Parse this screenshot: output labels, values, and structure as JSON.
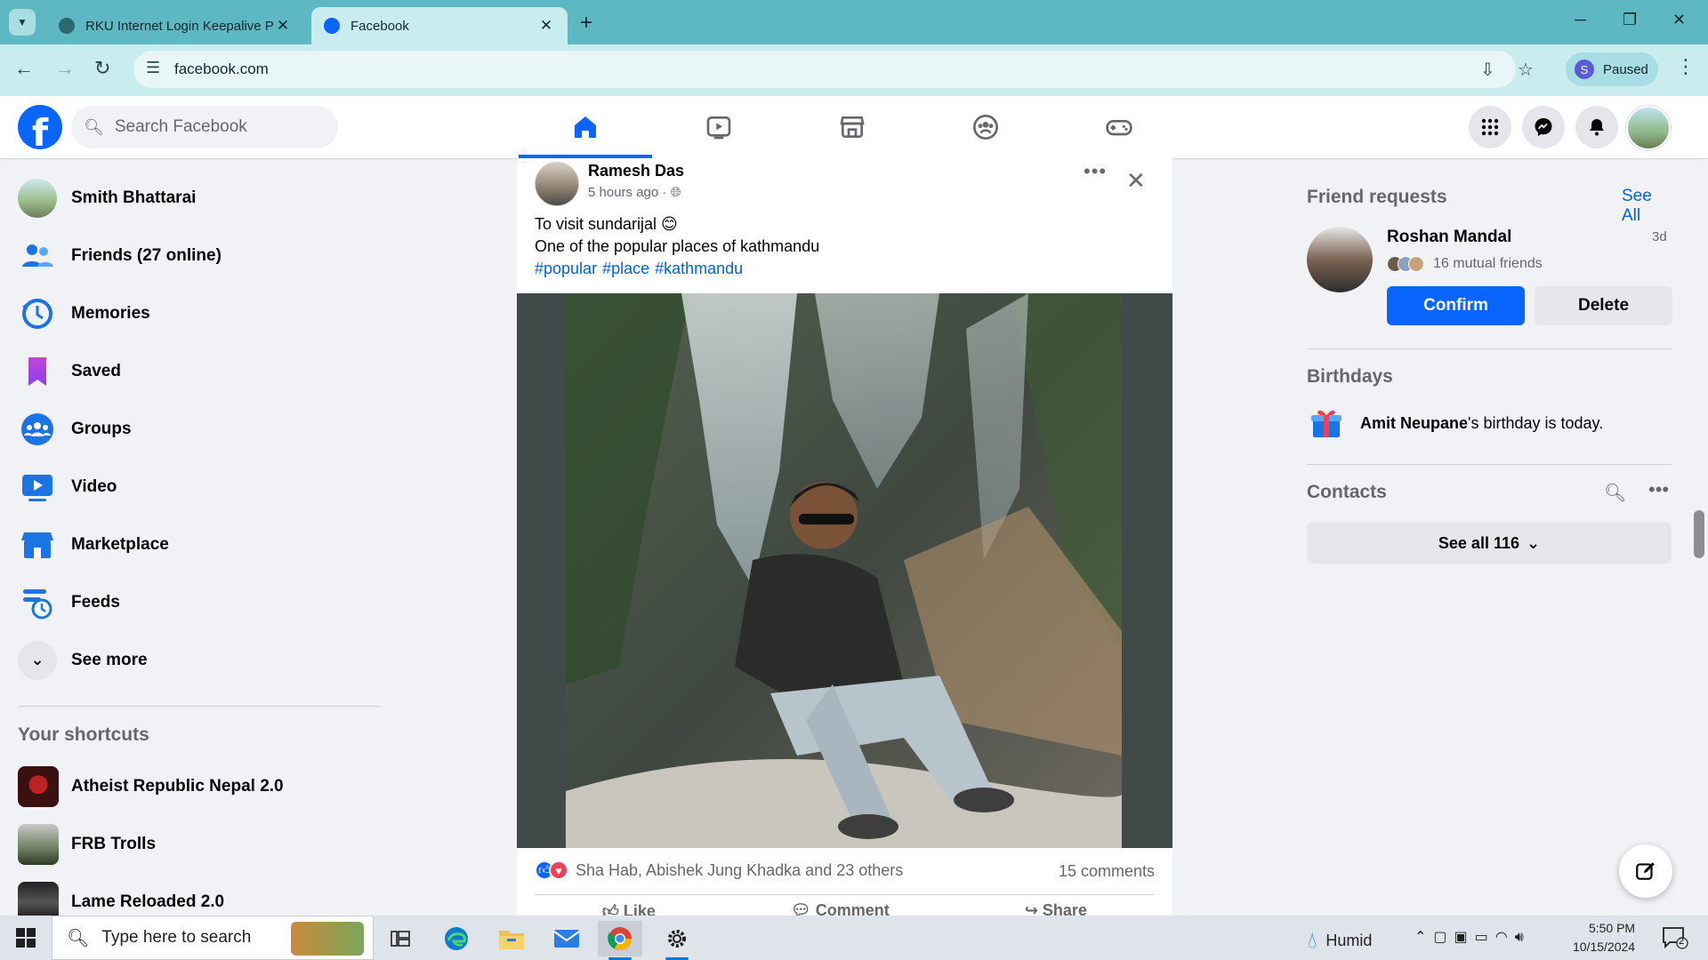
{
  "browser": {
    "tabs": [
      {
        "title": "RKU Internet Login Keepalive P",
        "active": false
      },
      {
        "title": "Facebook",
        "active": true
      }
    ],
    "url": "facebook.com",
    "profile_status": "Paused",
    "profile_initial": "S"
  },
  "header": {
    "search_placeholder": "Search Facebook",
    "nav": [
      "home-icon",
      "video-icon",
      "marketplace-icon",
      "groups-icon",
      "gaming-icon"
    ],
    "brand_color": "#0866ff"
  },
  "sidebar": {
    "items": [
      {
        "label": "Smith Bhattarai",
        "icon": "profile-avatar"
      },
      {
        "label": "Friends (27 online)",
        "icon": "friends-icon"
      },
      {
        "label": "Memories",
        "icon": "memories-icon"
      },
      {
        "label": "Saved",
        "icon": "saved-icon"
      },
      {
        "label": "Groups",
        "icon": "groups-icon"
      },
      {
        "label": "Video",
        "icon": "video-icon"
      },
      {
        "label": "Marketplace",
        "icon": "marketplace-icon"
      },
      {
        "label": "Feeds",
        "icon": "feeds-icon"
      },
      {
        "label": "See more",
        "icon": "chevron-down-icon"
      }
    ],
    "shortcuts_title": "Your shortcuts",
    "shortcuts": [
      {
        "label": "Atheist Republic Nepal 2.0"
      },
      {
        "label": "FRB Trolls"
      },
      {
        "label": "Lame Reloaded 2.0"
      }
    ]
  },
  "post": {
    "author": "Ramesh Das",
    "time": "5 hours ago ·",
    "line1": "To visit sundarijal 😊",
    "line2": "One of the popular places of kathmandu",
    "hashtags": [
      "#popular",
      "#place",
      "#kathmandu"
    ],
    "reactions_text": "Sha Hab, Abishek Jung Khadka and 23 others",
    "comments": "15 comments",
    "actions": [
      "Like",
      "Comment",
      "Share"
    ]
  },
  "right": {
    "friend_requests_title": "Friend requests",
    "see_all": "See All",
    "request": {
      "name": "Roshan Mandal",
      "time": "3d",
      "mutual": "16 mutual friends",
      "confirm": "Confirm",
      "delete": "Delete"
    },
    "birthdays_title": "Birthdays",
    "birthday_name": "Amit Neupane",
    "birthday_suffix": "'s birthday is today.",
    "contacts_title": "Contacts",
    "see_all_contacts": "See all 116"
  },
  "taskbar": {
    "search_placeholder": "Type here to search",
    "weather": "Humid",
    "time": "5:50 PM",
    "date": "10/15/2024",
    "notifications": "2"
  }
}
